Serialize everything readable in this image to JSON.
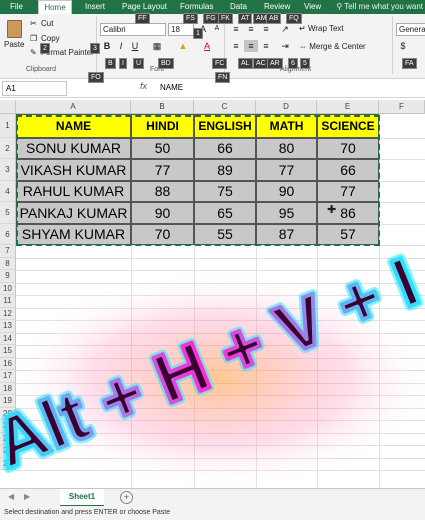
{
  "ribbon_tabs": [
    {
      "label": "File"
    },
    {
      "label": "Home"
    },
    {
      "label": "Insert"
    },
    {
      "label": "Page Layout"
    },
    {
      "label": "Formulas"
    },
    {
      "label": "Data"
    },
    {
      "label": "Review"
    },
    {
      "label": "View"
    }
  ],
  "tell_me": "Tell me what you want",
  "key_tips": {
    "ff": "FF",
    "fs": "FS",
    "fg": "FG",
    "fk": "FK",
    "at": "AT",
    "am": "AM",
    "ab": "AB",
    "fq": "FQ",
    "one": "1",
    "two": "2",
    "three": "3",
    "b": "B",
    "i": "I",
    "u": "U",
    "bd": "BD",
    "fc": "FC",
    "al": "AL",
    "ac": "AC",
    "ar": "AR",
    "six": "6",
    "five": "5",
    "fa": "FA",
    "fo": "FO",
    "fn": "FN"
  },
  "clipboard": {
    "paste": "Paste",
    "cut": "Cut",
    "copy": "Copy",
    "format_painter": "Format Painter",
    "group": "Clipboard"
  },
  "font": {
    "name": "Calibri",
    "size": "18",
    "group": "Font"
  },
  "alignment": {
    "wrap": "Wrap Text",
    "merge": "Merge & Center",
    "group": "Alignment"
  },
  "number": {
    "format": "General"
  },
  "formula_bar": {
    "name_box": "A1",
    "fx": "fx",
    "content": "NAME"
  },
  "columns": [
    "A",
    "B",
    "C",
    "D",
    "E",
    "F"
  ],
  "rows": [
    "1",
    "2",
    "3",
    "4",
    "5",
    "6",
    "7",
    "8",
    "9",
    "10",
    "11",
    "12",
    "13",
    "14",
    "15",
    "16",
    "17",
    "18",
    "19",
    "20",
    "21",
    "22",
    "23",
    "24"
  ],
  "table": {
    "headers": [
      "NAME",
      "HINDI",
      "ENGLISH",
      "MATH",
      "SCIENCE"
    ],
    "rows": [
      [
        "SONU KUMAR",
        "50",
        "66",
        "80",
        "70"
      ],
      [
        "VIKASH KUMAR",
        "77",
        "89",
        "77",
        "66"
      ],
      [
        "RAHUL KUMAR",
        "88",
        "75",
        "90",
        "77"
      ],
      [
        "PANKAJ KUMAR",
        "90",
        "65",
        "95",
        "86"
      ],
      [
        "SHYAM KUMAR",
        "70",
        "55",
        "87",
        "57"
      ]
    ]
  },
  "overlay_text": "Alt + H + V + I",
  "sheet_tab": "Sheet1",
  "status_text": "Select destination and press ENTER or choose Paste",
  "colors": {
    "excel_green": "#217346",
    "header_fill": "#ffff00",
    "data_fill": "#c8c8c8",
    "neon_pink": "#ff2ad4",
    "neon_cyan": "#27e8ff"
  }
}
